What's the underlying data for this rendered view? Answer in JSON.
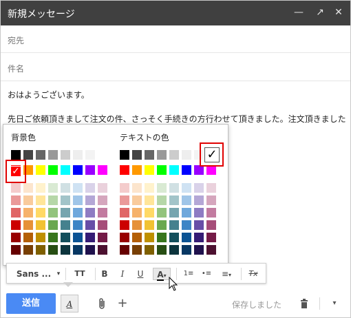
{
  "title": "新規メッセージ",
  "window_controls": {
    "minimize": "—",
    "popout": "↗",
    "close": "✕"
  },
  "fields": {
    "to_label": "宛先",
    "subject_label": "件名"
  },
  "body": {
    "line1": "おはようございます。",
    "line2": "先日ご依頼頂きまして注文の件、さっそく手続きの方行わせて頂きました。注文頂きました"
  },
  "color_popup": {
    "bg_header": "背景色",
    "text_header": "テキストの色",
    "check_mark": "✓",
    "selected_bg_color": "#ff0000",
    "selected_text_color": "#000000",
    "gray_row": [
      "#000000",
      "#444444",
      "#666666",
      "#999999",
      "#cccccc",
      "#eeeeee",
      "#f3f3f3",
      "#ffffff"
    ],
    "bright_row": [
      "#ff0000",
      "#ff9900",
      "#ffff00",
      "#00ff00",
      "#00ffff",
      "#0000ff",
      "#9900ff",
      "#ff00ff"
    ],
    "shade_rows": [
      [
        "#f4cccc",
        "#fce5cd",
        "#fff2cc",
        "#d9ead3",
        "#d0e0e3",
        "#cfe2f3",
        "#d9d2e9",
        "#ead1dc"
      ],
      [
        "#ea9999",
        "#f9cb9c",
        "#ffe599",
        "#b6d7a8",
        "#a2c4c9",
        "#9fc5e8",
        "#b4a7d6",
        "#d5a6bd"
      ],
      [
        "#e06666",
        "#f6b26b",
        "#ffd966",
        "#93c47d",
        "#76a5af",
        "#6fa8dc",
        "#8e7cc3",
        "#c27ba0"
      ],
      [
        "#cc0000",
        "#e69138",
        "#f1c232",
        "#6aa84f",
        "#45818e",
        "#3d85c6",
        "#674ea7",
        "#a64d79"
      ],
      [
        "#990000",
        "#b45f06",
        "#bf9000",
        "#38761d",
        "#134f5c",
        "#0b5394",
        "#351c75",
        "#741b47"
      ],
      [
        "#660000",
        "#783f04",
        "#7f6000",
        "#274e13",
        "#0c343d",
        "#073763",
        "#20124d",
        "#4c1130"
      ]
    ]
  },
  "format_toolbar": {
    "font": "Sans ...",
    "size_icon": "TT",
    "bold": "B",
    "italic": "I",
    "underline": "U",
    "text_color": "A",
    "numbered_list": "1≡",
    "bullet_list": "•≡",
    "align": "≡",
    "clear_format": "Tx"
  },
  "bottom_bar": {
    "send_label": "送信",
    "format_label": "A",
    "attach_icon": "📎",
    "more_icon": "+",
    "saved_label": "保存しました",
    "delete_icon": "🗑",
    "dropdown_icon": "▾"
  },
  "colors": {
    "titlebar": "#404040",
    "send_button": "#4a8af4",
    "highlight_box": "#e00000"
  }
}
